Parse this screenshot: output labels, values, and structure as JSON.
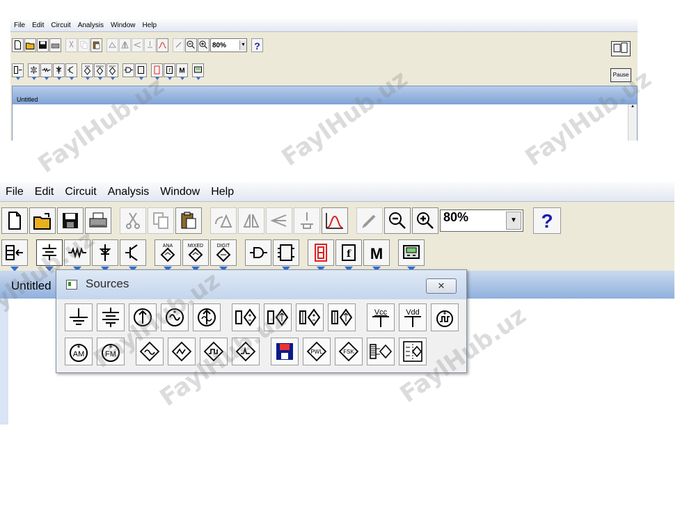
{
  "menu": [
    "File",
    "Edit",
    "Circuit",
    "Analysis",
    "Window",
    "Help"
  ],
  "toolbar": {
    "zoom_value": "80%",
    "help_label": "?",
    "pause_label": "Pause",
    "parts_bin_labels": {
      "analog_ics": "ANA",
      "mixed_ics": "MIXED",
      "digital_ics": "DIGIT",
      "misc": "M"
    }
  },
  "document": {
    "title": "Untitled"
  },
  "sources_window": {
    "title": "Sources",
    "close_label": "✕",
    "vcc_label": "Vcc",
    "vdd_label": "Vdd",
    "am_label": "AM",
    "fm_label": "FM",
    "pwl_label": "PWL",
    "fsk_label": "FSK"
  },
  "watermark": "FaylHub.uz",
  "colors": {
    "accent_arrow": "#2f6fd6",
    "help_blue": "#1c1cb2",
    "title_gradient": "#8fb0dd"
  }
}
